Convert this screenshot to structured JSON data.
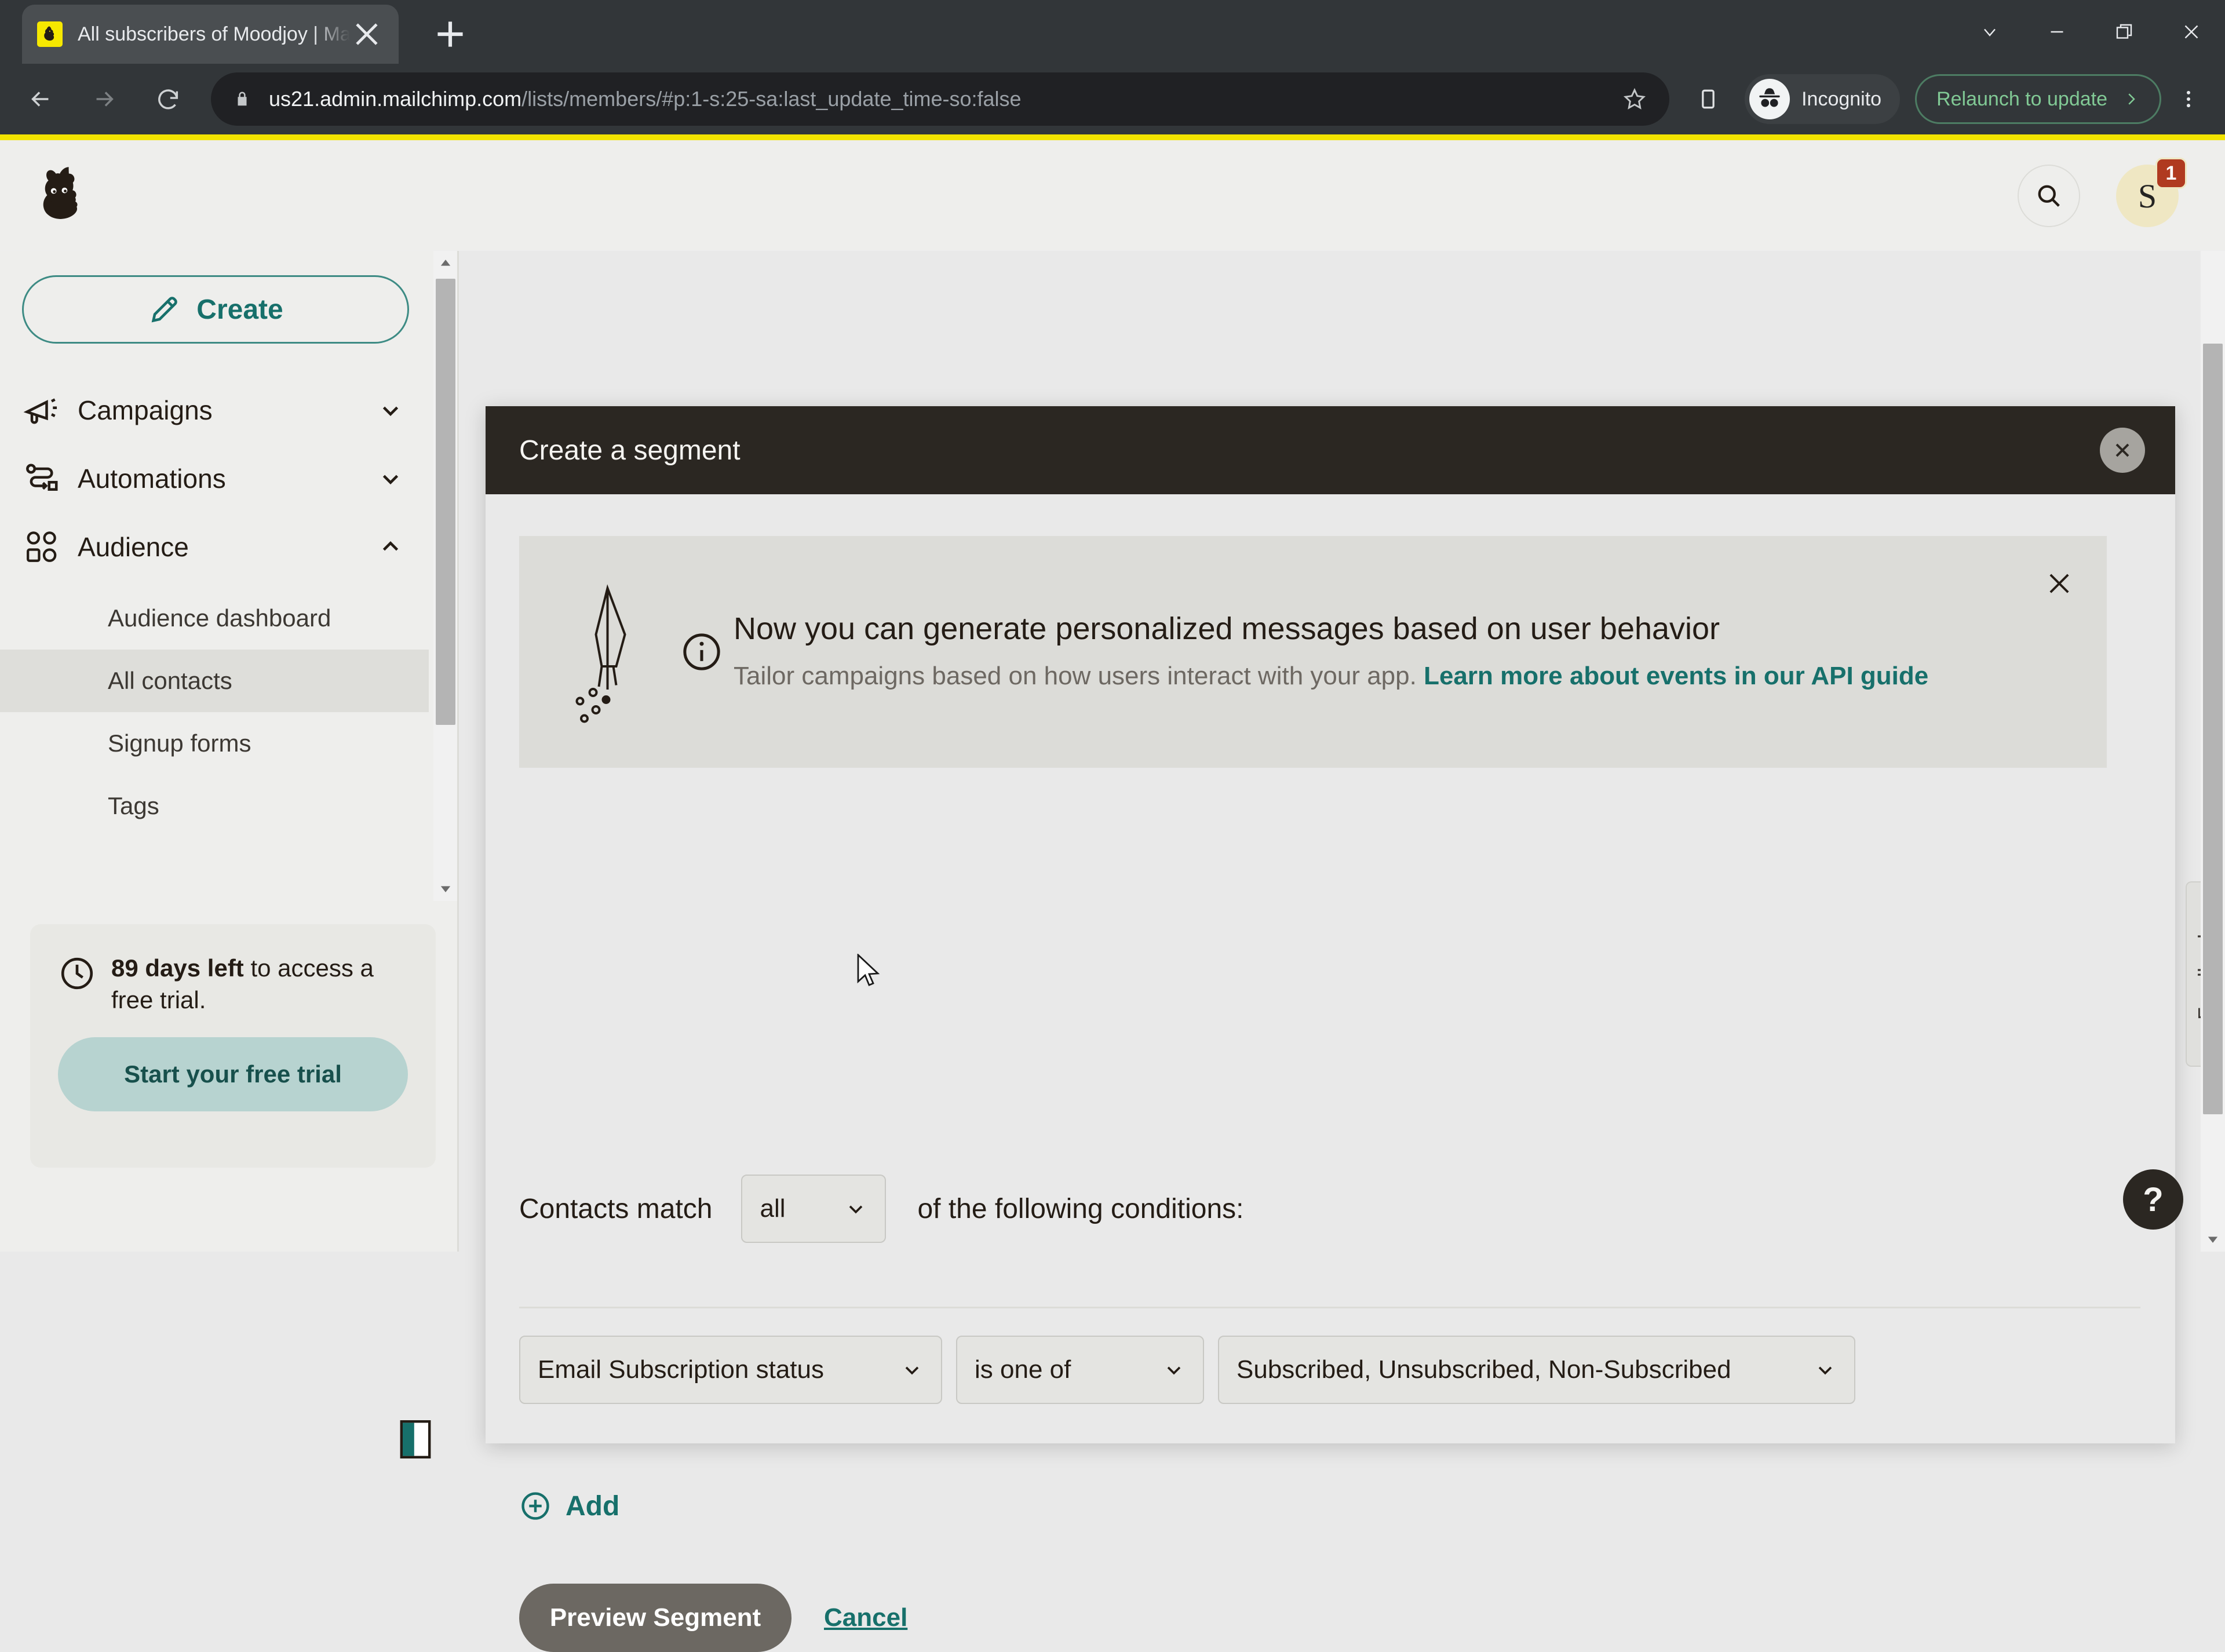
{
  "browser": {
    "tab": {
      "title": "All subscribers of Moodjoy | Mai",
      "favicon": "mailchimp-favicon",
      "close_label": "×"
    },
    "new_tab_label": "+",
    "window_controls": [
      "chevron-down-icon",
      "minimize-icon",
      "restore-icon",
      "close-icon"
    ],
    "nav": {
      "back": "back-arrow",
      "forward": "forward-arrow",
      "reload": "reload-icon"
    },
    "omnibox": {
      "lock": "lock-icon",
      "url_host": "us21.admin.mailchimp.com",
      "url_path": "/lists/members/#p:1-s:25-sa:last_update_time-so:false",
      "star": "bookmark-star-icon"
    },
    "side_panel_icon": "side-panel-icon",
    "incognito": {
      "label": "Incognito",
      "icon": "incognito-icon"
    },
    "relaunch": {
      "label": "Relaunch to update",
      "icon": "chevron-right-icon"
    },
    "menu_icon": "three-dot-menu-icon"
  },
  "app_header": {
    "logo": "mailchimp-freddie-logo",
    "search_icon": "search-icon",
    "avatar_letter": "S",
    "avatar_badge": "1"
  },
  "sidebar": {
    "create_button": "Create",
    "groups": [
      {
        "label": "Campaigns",
        "icon": "megaphone-icon",
        "chevron": "chevron-down-icon",
        "expanded": false
      },
      {
        "label": "Automations",
        "icon": "automation-flow-icon",
        "chevron": "chevron-down-icon",
        "expanded": false
      },
      {
        "label": "Audience",
        "icon": "audience-people-icon",
        "chevron": "chevron-up-icon",
        "expanded": true
      }
    ],
    "sub_items": [
      {
        "label": "Audience dashboard",
        "active": false
      },
      {
        "label": "All contacts",
        "active": true
      },
      {
        "label": "Signup forms",
        "active": false
      },
      {
        "label": "Tags",
        "active": false
      }
    ],
    "trial": {
      "days_bold": "89 days left",
      "rest": " to access a free trial.",
      "cta": "Start your free trial",
      "icon": "clock-icon"
    },
    "collapse_toggle_icon": "panel-collapse-icon"
  },
  "modal": {
    "title": "Create a segment",
    "close_icon": "close-icon",
    "banner": {
      "illustration": "pen-writing-illustration",
      "info_icon": "info-circle-icon",
      "title": "Now you can generate personalized messages based on user behavior",
      "body": "Tailor campaigns based on how users interact with your app. ",
      "link": "Learn more about events in our API guide",
      "close_icon": "close-icon"
    },
    "match": {
      "prefix": "Contacts match",
      "selected": "all",
      "suffix": "of the following conditions:",
      "chevron": "chevron-down-icon"
    },
    "condition": {
      "field": "Email Subscription status",
      "operator": "is one of",
      "value": "Subscribed, Unsubscribed, Non-Subscribed",
      "chevron": "chevron-down-icon"
    },
    "add": {
      "label": "Add",
      "icon": "plus-circle-icon"
    },
    "footer": {
      "primary": "Preview Segment",
      "secondary": "Cancel"
    }
  },
  "feedback_tab": "Feedback",
  "help_fab": "?",
  "colors": {
    "brand_yellow": "#f2e300",
    "teal": "#17706b",
    "dark": "#2b2722",
    "badge_red": "#b03a20",
    "chrome_dark": "#323639"
  }
}
